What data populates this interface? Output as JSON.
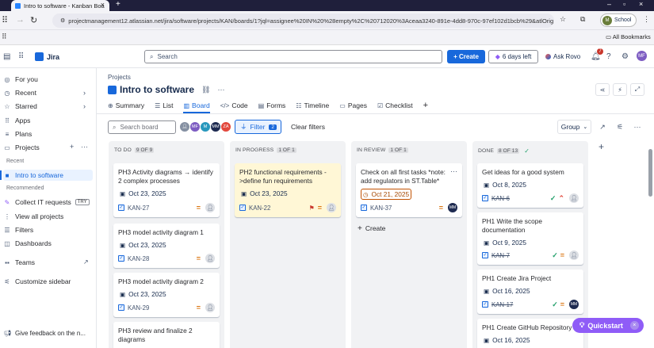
{
  "browser": {
    "tab_title": "Intro to software - Kanban Boa",
    "url": "projectmanagement12.atlassian.net/jira/software/projects/KAN/boards/1?jql=assignee%20IN%20%28empty%2C%20712020%3Aceaa3240-891e-4dd8-970c-97ef102d1bcb%29&atlOrig...",
    "profile_label": "School",
    "bookmarks_label": "All Bookmarks"
  },
  "topnav": {
    "app_name": "Jira",
    "search_placeholder": "Search",
    "create_label": "+ Create",
    "trial_label": "6 days left",
    "rovo_label": "Ask Rovo",
    "notif_count": "7",
    "user_initials": "MF"
  },
  "sidebar": {
    "items": [
      {
        "label": "For you",
        "icon": "user-circle-icon"
      },
      {
        "label": "Recent",
        "icon": "clock-icon"
      },
      {
        "label": "Starred",
        "icon": "star-icon"
      },
      {
        "label": "Apps",
        "icon": "apps-icon"
      },
      {
        "label": "Plans",
        "icon": "plans-icon"
      },
      {
        "label": "Projects",
        "icon": "folder-icon"
      }
    ],
    "recent_heading": "Recent",
    "current_project": "Intro to software",
    "recommended_heading": "Recommended",
    "collect_label": "Collect IT requests",
    "try_label": "TRY",
    "view_all_label": "View all projects",
    "filters_label": "Filters",
    "dashboards_label": "Dashboards",
    "teams_label": "Teams",
    "customize_label": "Customize sidebar",
    "feedback_label": "Give feedback on the n..."
  },
  "project": {
    "breadcrumb": "Projects",
    "title": "Intro to software",
    "tabs": [
      "Summary",
      "List",
      "Board",
      "Code",
      "Forms",
      "Timeline",
      "Pages",
      "Checklist"
    ],
    "active_tab": "Board"
  },
  "toolbar": {
    "search_placeholder": "Search board",
    "avatars": [
      {
        "initials": "",
        "color": "#8590a2"
      },
      {
        "initials": "MF",
        "color": "#7d5cc2"
      },
      {
        "initials": "M",
        "color": "#2898bd"
      },
      {
        "initials": "MM",
        "color": "#1d2a50"
      },
      {
        "initials": "ZA",
        "color": "#e2483d"
      }
    ],
    "filter_label": "Filter",
    "filter_count": "2",
    "clear_label": "Clear filters",
    "group_label": "Group"
  },
  "columns": [
    {
      "name": "TO DO",
      "count": "9 OF 9",
      "cards": [
        {
          "title": "PH3 Activity diagrams → identify 2 complex processes",
          "date": "Oct 23, 2025",
          "key": "KAN-27"
        },
        {
          "title": "PH3 model activity diagram 1",
          "date": "Oct 23, 2025",
          "key": "KAN-28"
        },
        {
          "title": "PH3 model activity diagram 2",
          "date": "Oct 23, 2025",
          "key": "KAN-29"
        },
        {
          "title": "PH3 review and finalize 2 diagrams",
          "date": "",
          "key": ""
        }
      ]
    },
    {
      "name": "IN PROGRESS",
      "count": "1 OF 1",
      "cards": [
        {
          "title": "PH2 functional requirements ->define fun requirements",
          "date": "Oct 23, 2025",
          "key": "KAN-22"
        }
      ]
    },
    {
      "name": "IN REVIEW",
      "count": "1 OF 1",
      "cards": [
        {
          "title": "Check on all first tasks *note: add regulators in ST.Table*",
          "date": "Oct 21, 2025",
          "key": "KAN-37",
          "assignee": "MM"
        }
      ],
      "create_label": "Create"
    },
    {
      "name": "DONE",
      "count": "8 OF 13",
      "cards": [
        {
          "title": "Get ideas for a good system",
          "date": "Oct 8, 2025",
          "key": "KAN-6"
        },
        {
          "title": "PH1 Write the scope documentation",
          "date": "Oct 9, 2025",
          "key": "KAN-7"
        },
        {
          "title": "PH1 Create Jira Project",
          "date": "Oct 16, 2025",
          "key": "KAN-17",
          "assignee": "MM"
        },
        {
          "title": "PH1 Create GitHub Repository",
          "date": "Oct 16, 2025",
          "key": ""
        }
      ]
    }
  ],
  "quickstart_label": "Quickstart",
  "colors": {
    "accent": "#1868db",
    "in_progress_card": "#fff7d6",
    "done_check": "#22a06b",
    "quickstart": "#8f5cf7"
  }
}
